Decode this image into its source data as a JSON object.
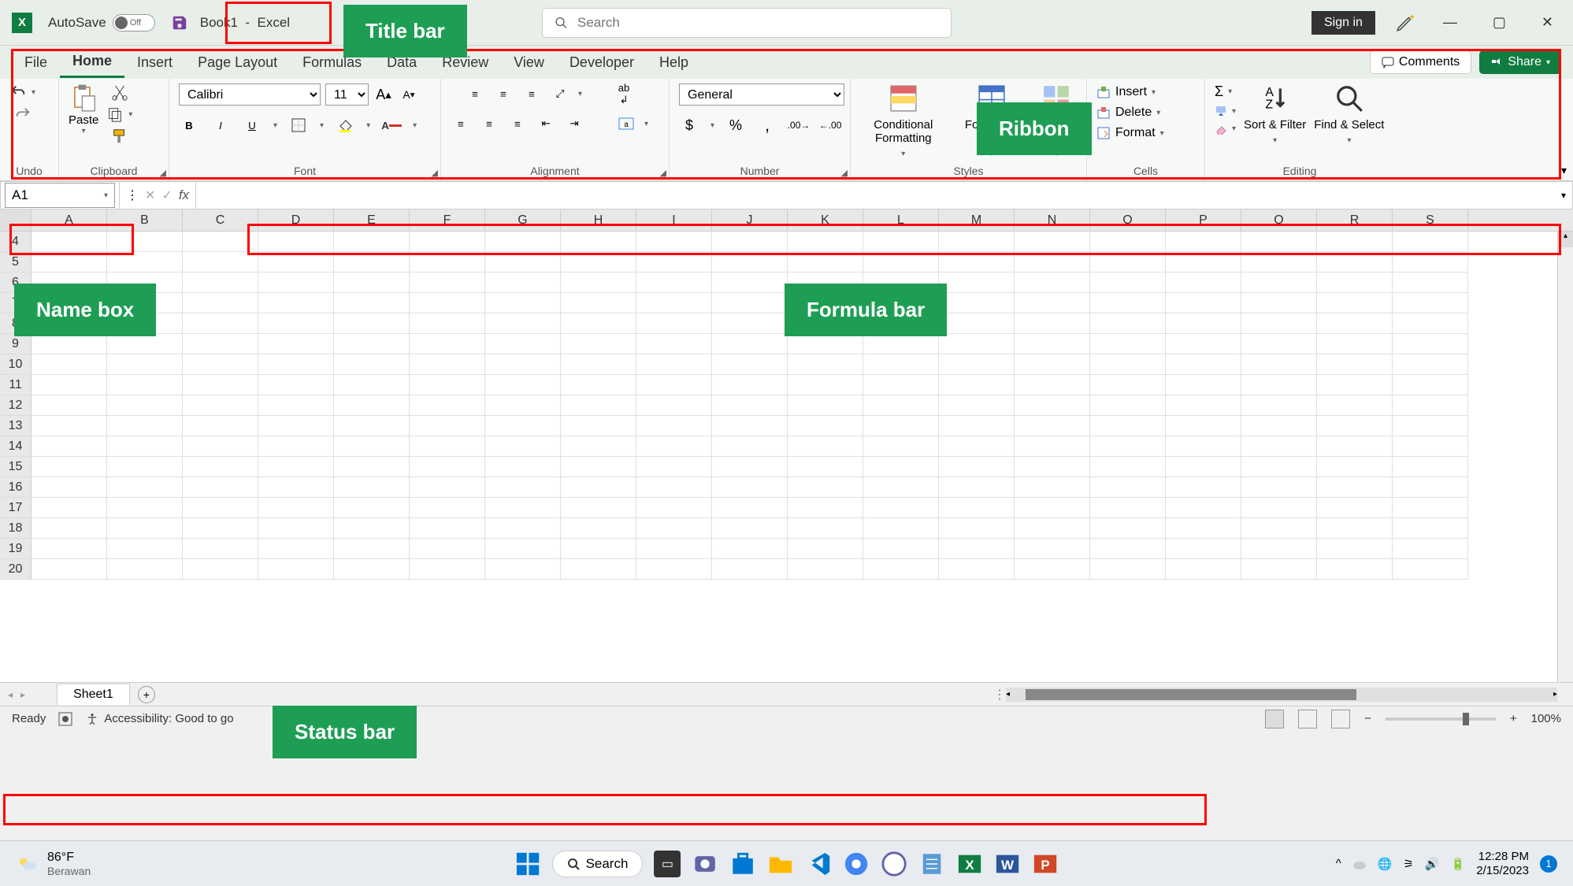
{
  "title_bar": {
    "app_icon_letter": "X",
    "autosave_label": "AutoSave",
    "autosave_state": "Off",
    "document_name": "Book1",
    "app_name": "Excel",
    "search_placeholder": "Search",
    "signin_label": "Sign in"
  },
  "ribbon_tabs": [
    "File",
    "Home",
    "Insert",
    "Page Layout",
    "Formulas",
    "Data",
    "Review",
    "View",
    "Developer",
    "Help"
  ],
  "ribbon_active_tab": "Home",
  "ribbon_right": {
    "comments": "Comments",
    "share": "Share"
  },
  "ribbon_groups": {
    "undo": "Undo",
    "clipboard": {
      "label": "Clipboard",
      "paste": "Paste"
    },
    "font": {
      "label": "Font",
      "name": "Calibri",
      "size": "11"
    },
    "alignment": "Alignment",
    "number": {
      "label": "Number",
      "format": "General"
    },
    "styles": {
      "label": "Styles",
      "cond": "Conditional Formatting",
      "table": "Format as Table",
      "cell": "Cell Styles"
    },
    "cells": {
      "label": "Cells",
      "insert": "Insert",
      "delete": "Delete",
      "format": "Format"
    },
    "editing": {
      "label": "Editing",
      "sort": "Sort & Filter",
      "find": "Find & Select"
    }
  },
  "formula_bar": {
    "name_box": "A1",
    "formula": ""
  },
  "columns": [
    "A",
    "B",
    "C",
    "D",
    "E",
    "F",
    "G",
    "H",
    "I",
    "J",
    "K",
    "L",
    "M",
    "N",
    "O",
    "P",
    "Q",
    "R",
    "S"
  ],
  "rows": [
    4,
    5,
    6,
    7,
    8,
    9,
    10,
    11,
    12,
    13,
    14,
    15,
    16,
    17,
    18,
    19,
    20
  ],
  "sheet": {
    "name": "Sheet1"
  },
  "status": {
    "ready": "Ready",
    "accessibility": "Accessibility: Good to go",
    "zoom": "100%"
  },
  "taskbar": {
    "temp": "86°F",
    "weather": "Berawan",
    "search": "Search",
    "time": "12:28 PM",
    "date": "2/15/2023",
    "notif_count": "1"
  },
  "annotations": {
    "title_bar": "Title bar",
    "ribbon": "Ribbon",
    "name_box": "Name box",
    "formula_bar": "Formula bar",
    "status_bar": "Status bar"
  }
}
